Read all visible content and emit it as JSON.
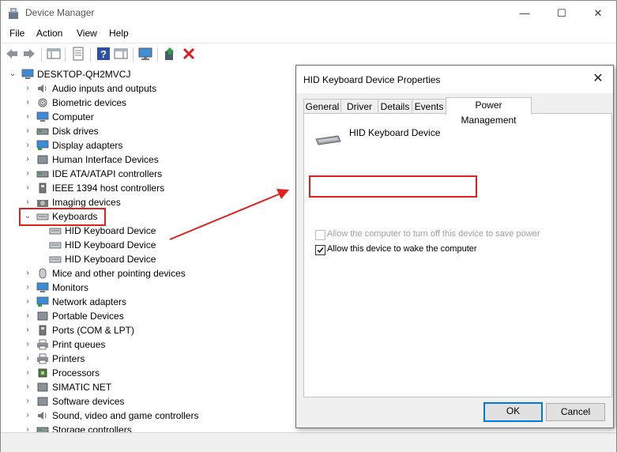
{
  "window": {
    "title": "Device Manager",
    "minimize_glyph": "—",
    "maximize_glyph": "☐",
    "close_glyph": "✕"
  },
  "menu": [
    "File",
    "Action",
    "View",
    "Help"
  ],
  "toolbar": {
    "icons": [
      "back-arrow-icon",
      "forward-arrow-icon",
      "show-hide-console-tree-icon",
      "properties-icon",
      "help-icon",
      "action-pane-icon",
      "display-icon",
      "update-driver-icon",
      "uninstall-device-icon"
    ]
  },
  "tree": {
    "root": "DESKTOP-QH2MVCJ",
    "categories": [
      {
        "label": "Audio inputs and outputs",
        "icon": "speaker-icon"
      },
      {
        "label": "Biometric devices",
        "icon": "fingerprint-icon"
      },
      {
        "label": "Computer",
        "icon": "computer-icon"
      },
      {
        "label": "Disk drives",
        "icon": "disk-drive-icon"
      },
      {
        "label": "Display adapters",
        "icon": "display-adapter-icon"
      },
      {
        "label": "Human Interface Devices",
        "icon": "hid-icon"
      },
      {
        "label": "IDE ATA/ATAPI controllers",
        "icon": "ide-controller-icon"
      },
      {
        "label": "IEEE 1394 host controllers",
        "icon": "ieee1394-icon"
      },
      {
        "label": "Imaging devices",
        "icon": "camera-icon"
      },
      {
        "label": "Keyboards",
        "icon": "keyboard-icon"
      },
      {
        "label": "Mice and other pointing devices",
        "icon": "mouse-icon"
      },
      {
        "label": "Monitors",
        "icon": "monitor-icon"
      },
      {
        "label": "Network adapters",
        "icon": "network-adapter-icon"
      },
      {
        "label": "Portable Devices",
        "icon": "portable-device-icon"
      },
      {
        "label": "Ports (COM & LPT)",
        "icon": "port-icon"
      },
      {
        "label": "Print queues",
        "icon": "print-queue-icon"
      },
      {
        "label": "Printers",
        "icon": "printer-icon"
      },
      {
        "label": "Processors",
        "icon": "processor-icon"
      },
      {
        "label": "SIMATIC NET",
        "icon": "simatic-net-icon"
      },
      {
        "label": "Software devices",
        "icon": "software-device-icon"
      },
      {
        "label": "Sound, video and game controllers",
        "icon": "sound-controller-icon"
      },
      {
        "label": "Storage controllers",
        "icon": "storage-controller-icon"
      }
    ],
    "keyboard_children": [
      "HID Keyboard Device",
      "HID Keyboard Device",
      "HID Keyboard Device"
    ]
  },
  "dialog": {
    "title": "HID Keyboard Device Properties",
    "close_glyph": "✕",
    "tabs": [
      "General",
      "Driver",
      "Details",
      "Events",
      "Power Management"
    ],
    "active_tab": "Power Management",
    "device_name": "HID Keyboard Device",
    "options": [
      {
        "label": "Allow the computer to turn off this device to save power",
        "checked": false,
        "enabled": false
      },
      {
        "label": "Allow this device to wake the computer",
        "checked": true,
        "enabled": true
      }
    ],
    "ok_label": "OK",
    "cancel_label": "Cancel"
  },
  "colors": {
    "highlight": "#e0201c",
    "accent": "#0078d7"
  }
}
